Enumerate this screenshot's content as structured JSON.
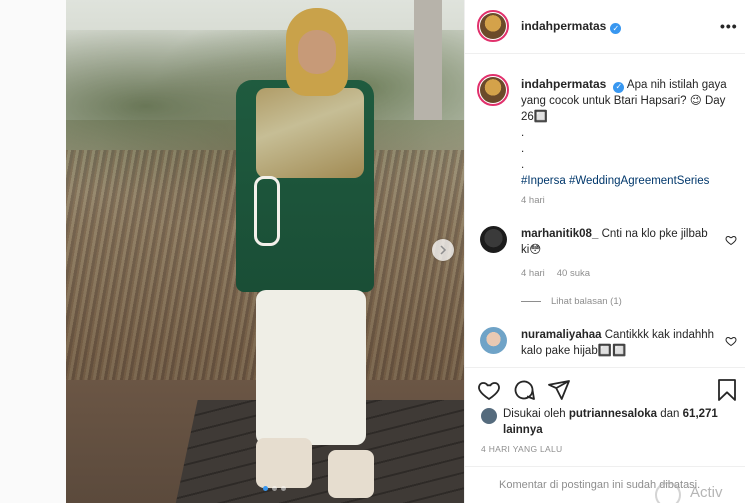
{
  "post": {
    "username": "indahpermatas",
    "caption_text": "Apa nih istilah gaya yang cocok untuk Btari Hapsari? 😉 Day 26🔲",
    "caption_dots": [
      ".",
      ".",
      "."
    ],
    "hashtags": "#Inpersa #WeddingAgreementSeries",
    "caption_time": "4 hari",
    "more_label": "•••"
  },
  "comments": [
    {
      "username": "marhanitik08_",
      "text": "Cnti na klo pke jilbab ki😳",
      "time": "4 hari",
      "likes": "40 suka",
      "replies": "Lihat balasan (1)"
    },
    {
      "username": "nuramaliyahaa",
      "text": "Cantikkk kak indahhh kalo pake hijab🔲🔲"
    }
  ],
  "likes": {
    "prefix": "Disukai oleh",
    "user": "putriannesaloka",
    "connector": "dan",
    "count": "61,271 lainnya"
  },
  "post_time": "4 HARI YANG LALU",
  "comments_limited": "Komentar di postingan ini sudah dibatasi.",
  "watermark": "Activ",
  "carousel": {
    "total": 3,
    "active": 0
  },
  "icons": [
    "more-icon",
    "verified-icon",
    "heart-icon",
    "comment-icon",
    "share-icon",
    "bookmark-icon",
    "next-arrow-icon"
  ],
  "colors": {
    "accent": "#3897f0",
    "hashtag": "#00376b",
    "muted": "#8e8e8e",
    "story_ring": "#e1306c"
  }
}
